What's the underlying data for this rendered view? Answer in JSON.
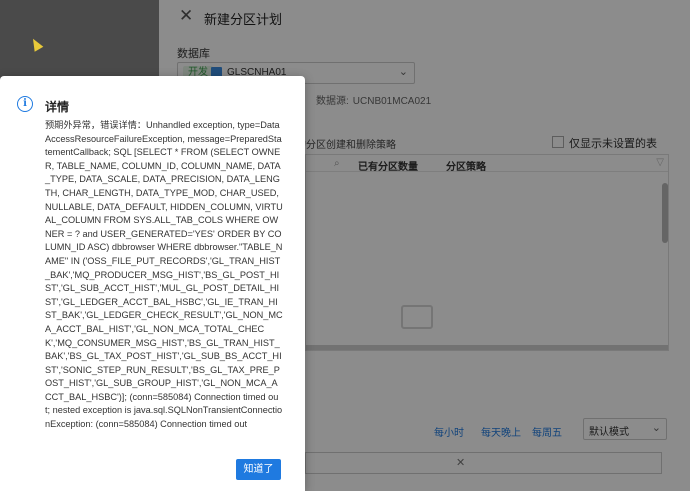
{
  "drawer": {
    "title": "新建分区计划",
    "db_label": "数据库",
    "db_env_tag": "开发",
    "db_name": "GLSCNHA01",
    "datasource_label": "数据源:",
    "datasource_value": "UCNB01MCA021",
    "rule_text": "应的分区创建和删除策略",
    "checkbox_label": "仅显示未设置的表",
    "table_headers": [
      "已有分区数量",
      "分区策略"
    ],
    "freq_links": [
      "每小时",
      "每天晚上",
      "每周五"
    ],
    "mode_select_value": "默认模式"
  },
  "modal": {
    "title": "详情",
    "ok_label": "知道了",
    "body": "预期外异常，错误详情：Unhandled exception, type=DataAccessResourceFailureException, message=PreparedStatementCallback; SQL [SELECT * FROM (SELECT OWNER, TABLE_NAME, COLUMN_ID, COLUMN_NAME, DATA_TYPE, DATA_SCALE, DATA_PRECISION, DATA_LENGTH, CHAR_LENGTH, DATA_TYPE_MOD, CHAR_USED, NULLABLE, DATA_DEFAULT, HIDDEN_COLUMN, VIRTUAL_COLUMN FROM SYS.ALL_TAB_COLS WHERE OWNER = ? and USER_GENERATED='YES' ORDER BY COLUMN_ID ASC) dbbrowser WHERE dbbrowser.\"TABLE_NAME\" IN ('OSS_FILE_PUT_RECORDS','GL_TRAN_HIST_BAK','MQ_PRODUCER_MSG_HIST','BS_GL_POST_HIST','GL_SUB_ACCT_HIST','MUL_GL_POST_DETAIL_HIST','GL_LEDGER_ACCT_BAL_HSBC','GL_IE_TRAN_HIST_BAK','GL_LEDGER_CHECK_RESULT','GL_NON_MCA_ACCT_BAL_HIST','GL_NON_MCA_TOTAL_CHECK','MQ_CONSUMER_MSG_HIST','BS_GL_TRAN_HIST_BAK','BS_GL_TAX_POST_HIST','GL_SUB_BS_ACCT_HIST','SONIC_STEP_RUN_RESULT','BS_GL_TAX_PRE_POST_HIST','GL_SUB_GROUP_HIST','GL_NON_MCA_ACCT_BAL_HSBC')]; (conn=585084) Connection timed out; nested exception is java.sql.SQLNonTransientConnectionException: (conn=585084) Connection timed out"
  },
  "icons": {
    "close": "close-icon",
    "info": "info-icon",
    "chevron": "chevron-down-icon"
  }
}
